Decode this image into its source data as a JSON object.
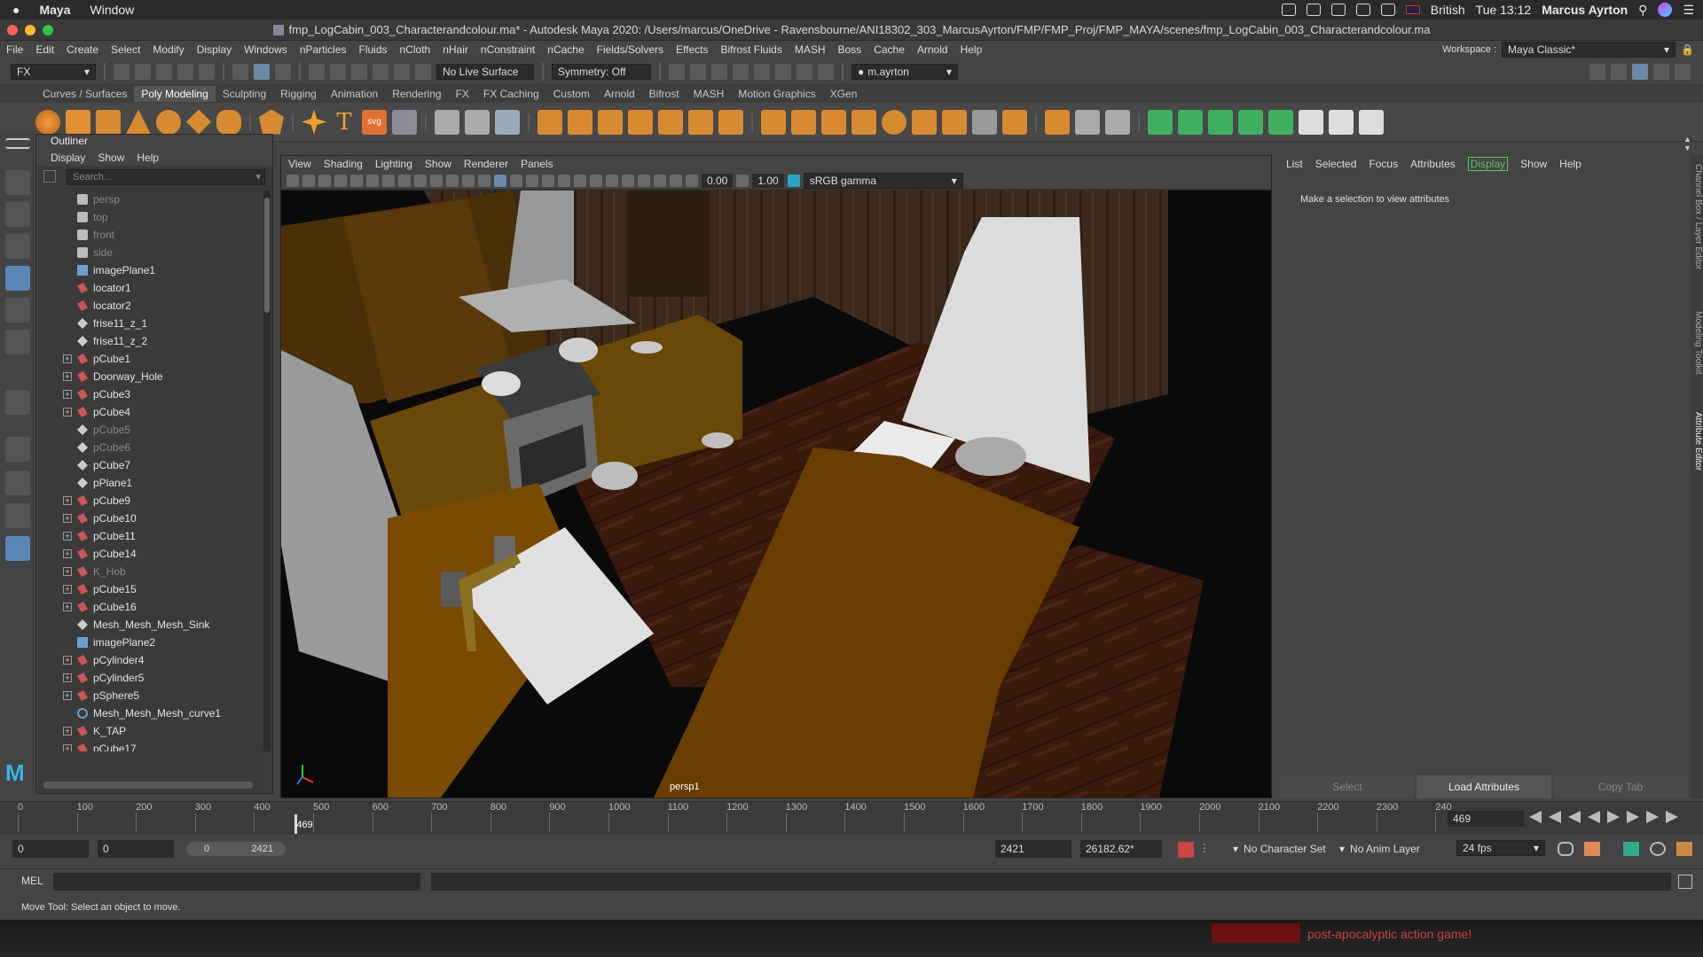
{
  "mac_menubar": {
    "app": "Maya",
    "window_menu": "Window",
    "language": "British",
    "clock": "Tue 13:12",
    "user": "Marcus Ayrton"
  },
  "title": "fmp_LogCabin_003_Characterandcolour.ma* - Autodesk Maya 2020: /Users/marcus/OneDrive - Ravensbourne/ANI18302_303_MarcusAyrton/FMP/FMP_Proj/FMP_MAYA/scenes/fmp_LogCabin_003_Characterandcolour.ma",
  "menus": [
    "File",
    "Edit",
    "Create",
    "Select",
    "Modify",
    "Display",
    "Windows",
    "nParticles",
    "Fluids",
    "nCloth",
    "nHair",
    "nConstraint",
    "nCache",
    "Fields/Solvers",
    "Effects",
    "Bifrost Fluids",
    "MASH",
    "Boss",
    "Cache",
    "Arnold",
    "Help"
  ],
  "workspace": {
    "label": "Workspace :",
    "value": "Maya Classic*"
  },
  "status_line": {
    "menu_set": "FX",
    "live_surface": "No Live Surface",
    "symmetry": "Symmetry: Off",
    "login": "m.ayrton"
  },
  "shelf_tabs": [
    "Curves / Surfaces",
    "Poly Modeling",
    "Sculpting",
    "Rigging",
    "Animation",
    "Rendering",
    "FX",
    "FX Caching",
    "Custom",
    "Arnold",
    "Bifrost",
    "MASH",
    "Motion Graphics",
    "XGen"
  ],
  "shelf_active": "Poly Modeling",
  "outliner": {
    "title": "Outliner",
    "menu": [
      "Display",
      "Show",
      "Help"
    ],
    "search_placeholder": "Search...",
    "items": [
      {
        "name": "persp",
        "icon": "camera-icon",
        "expand": false,
        "dim": true
      },
      {
        "name": "top",
        "icon": "camera-icon",
        "expand": false,
        "dim": true
      },
      {
        "name": "front",
        "icon": "camera-icon",
        "expand": false,
        "dim": true
      },
      {
        "name": "side",
        "icon": "camera-icon",
        "expand": false,
        "dim": true
      },
      {
        "name": "imagePlane1",
        "icon": "image-plane-icon",
        "expand": false,
        "dim": false
      },
      {
        "name": "locator1",
        "icon": "transform-icon",
        "expand": false,
        "dim": false
      },
      {
        "name": "locator2",
        "icon": "transform-icon",
        "expand": false,
        "dim": false
      },
      {
        "name": "frise11_z_1",
        "icon": "group-icon",
        "expand": false,
        "dim": false
      },
      {
        "name": "frise11_z_2",
        "icon": "group-icon",
        "expand": false,
        "dim": false
      },
      {
        "name": "pCube1",
        "icon": "transform-icon",
        "expand": true,
        "dim": false
      },
      {
        "name": "Doorway_Hole",
        "icon": "transform-icon",
        "expand": true,
        "dim": false
      },
      {
        "name": "pCube3",
        "icon": "transform-icon",
        "expand": true,
        "dim": false
      },
      {
        "name": "pCube4",
        "icon": "transform-icon",
        "expand": true,
        "dim": false
      },
      {
        "name": "pCube5",
        "icon": "group-icon",
        "expand": false,
        "dim": true
      },
      {
        "name": "pCube6",
        "icon": "group-icon",
        "expand": false,
        "dim": true
      },
      {
        "name": "pCube7",
        "icon": "group-icon",
        "expand": false,
        "dim": false
      },
      {
        "name": "pPlane1",
        "icon": "group-icon",
        "expand": false,
        "dim": false
      },
      {
        "name": "pCube9",
        "icon": "transform-icon",
        "expand": true,
        "dim": false
      },
      {
        "name": "pCube10",
        "icon": "transform-icon",
        "expand": true,
        "dim": false
      },
      {
        "name": "pCube11",
        "icon": "transform-icon",
        "expand": true,
        "dim": false
      },
      {
        "name": "pCube14",
        "icon": "transform-icon",
        "expand": true,
        "dim": false
      },
      {
        "name": "K_Hob",
        "icon": "transform-icon",
        "expand": true,
        "dim": true
      },
      {
        "name": "pCube15",
        "icon": "transform-icon",
        "expand": true,
        "dim": false
      },
      {
        "name": "pCube16",
        "icon": "transform-icon",
        "expand": true,
        "dim": false
      },
      {
        "name": "Mesh_Mesh_Mesh_Sink",
        "icon": "group-icon",
        "expand": false,
        "dim": false
      },
      {
        "name": "imagePlane2",
        "icon": "image-plane-icon",
        "expand": false,
        "dim": false
      },
      {
        "name": "pCylinder4",
        "icon": "transform-icon",
        "expand": true,
        "dim": false
      },
      {
        "name": "pCylinder5",
        "icon": "transform-icon",
        "expand": true,
        "dim": false
      },
      {
        "name": "pSphere5",
        "icon": "transform-icon",
        "expand": true,
        "dim": false
      },
      {
        "name": "Mesh_Mesh_Mesh_curve1",
        "icon": "curve-icon",
        "expand": false,
        "dim": false
      },
      {
        "name": "K_TAP",
        "icon": "transform-icon",
        "expand": true,
        "dim": false
      },
      {
        "name": "pCube17",
        "icon": "transform-icon",
        "expand": true,
        "dim": false
      }
    ]
  },
  "viewport": {
    "menu": [
      "View",
      "Shading",
      "Lighting",
      "Show",
      "Renderer",
      "Panels"
    ],
    "exposure": "0.00",
    "gamma": "1.00",
    "color_space": "sRGB gamma",
    "camera_label": "persp1"
  },
  "attribute_editor": {
    "menu": [
      "List",
      "Selected",
      "Focus",
      "Attributes",
      "Display",
      "Show",
      "Help"
    ],
    "highlight": "Display",
    "message": "Make a selection to view attributes",
    "buttons": [
      "Select",
      "Load Attributes",
      "Copy Tab"
    ],
    "side_tabs": [
      "Channel Box / Layer Editor",
      "Modeling Toolkit",
      "Attribute Editor"
    ]
  },
  "timeline": {
    "ticks": [
      "0",
      "100",
      "200",
      "300",
      "400",
      "500",
      "600",
      "700",
      "800",
      "900",
      "1000",
      "1100",
      "1200",
      "1300",
      "1400",
      "1500",
      "1600",
      "1700",
      "1800",
      "1900",
      "2000",
      "2100",
      "2200",
      "2300",
      "240"
    ],
    "current_frame": "469",
    "current_frame_field": "469"
  },
  "range": {
    "start": "0",
    "playback_start": "0",
    "slider_min": "0",
    "slider_max": "2421",
    "playback_end": "2421",
    "end": "26182.62*",
    "character_set": "No Character Set",
    "anim_layer": "No Anim Layer",
    "fps": "24 fps"
  },
  "command_line": {
    "label": "MEL"
  },
  "help_line": "Move Tool: Select an object to move.",
  "desktop_text": "post-apocalyptic action game!"
}
